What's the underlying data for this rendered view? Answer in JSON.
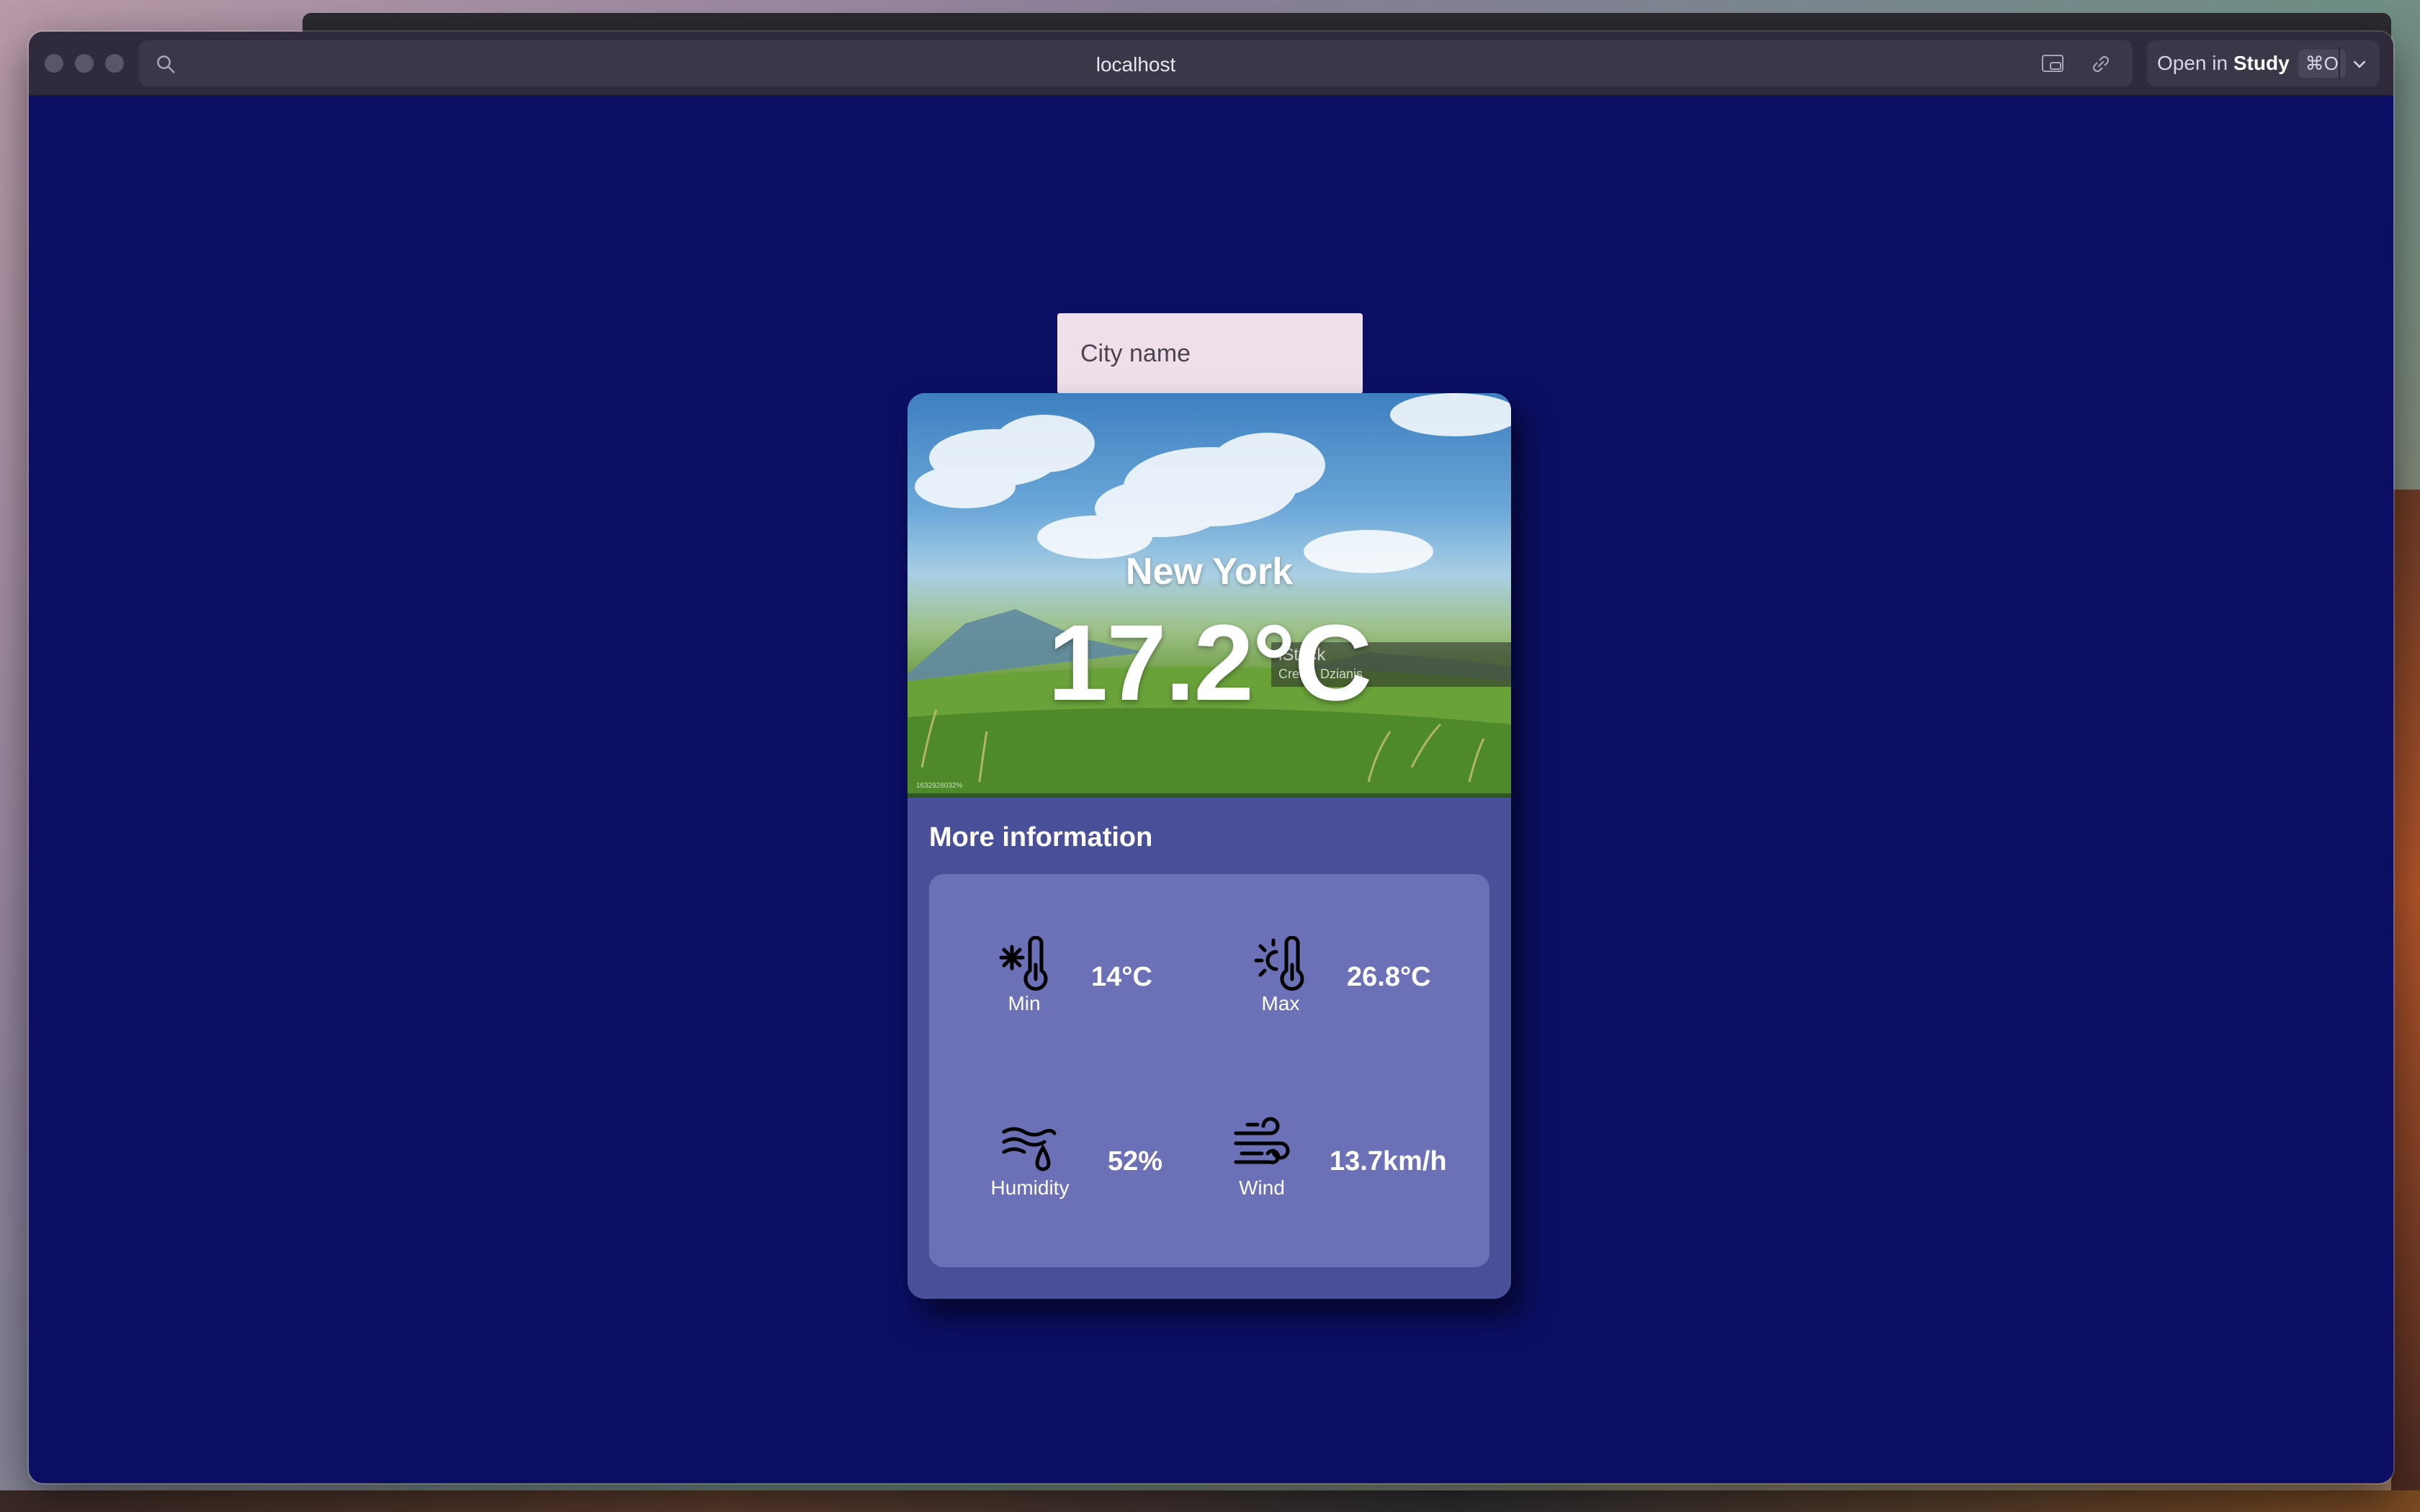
{
  "browser": {
    "url": "localhost",
    "open_in_prefix": "Open in",
    "open_in_app": "Study",
    "shortcut": "⌘O"
  },
  "search": {
    "placeholder": "City name"
  },
  "weather": {
    "city": "New York",
    "temperature": "17.2°C",
    "image_watermark": "iStock",
    "image_credit": "Credit: Dzianis",
    "image_id": "1632926032%",
    "section_title": "More information",
    "stats": {
      "min": {
        "label": "Min",
        "value": "14°C",
        "icon": "thermometer-cold-icon"
      },
      "max": {
        "label": "Max",
        "value": "26.8°C",
        "icon": "thermometer-hot-icon"
      },
      "humidity": {
        "label": "Humidity",
        "value": "52%",
        "icon": "humidity-icon"
      },
      "wind": {
        "label": "Wind",
        "value": "13.7km/h",
        "icon": "wind-icon"
      }
    }
  },
  "colors": {
    "page_background": "#0c0e63",
    "card_background": "#4a4f9a",
    "panel_background": "#6b70b7",
    "input_background": "#efdfea"
  }
}
